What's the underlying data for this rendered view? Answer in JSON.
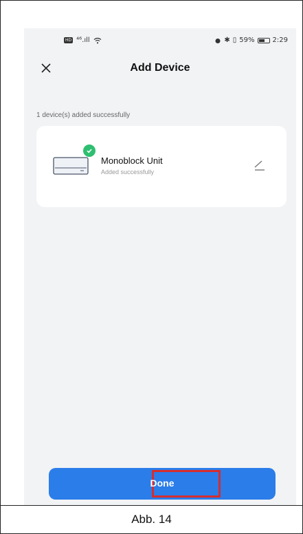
{
  "status_bar": {
    "left_text": "⁴⁶.ıll",
    "battery_text": "59%",
    "time": "2:29",
    "battery_level": 0.59
  },
  "header": {
    "title": "Add Device"
  },
  "summary": {
    "text": "1 device(s) added successfully"
  },
  "device": {
    "name": "Monoblock Unit",
    "status": "Added successfully"
  },
  "footer": {
    "done_label": "Done"
  },
  "caption": "Abb. 14",
  "colors": {
    "accent": "#2b7de9",
    "success": "#2fbf71",
    "highlight": "#d62d2d"
  }
}
